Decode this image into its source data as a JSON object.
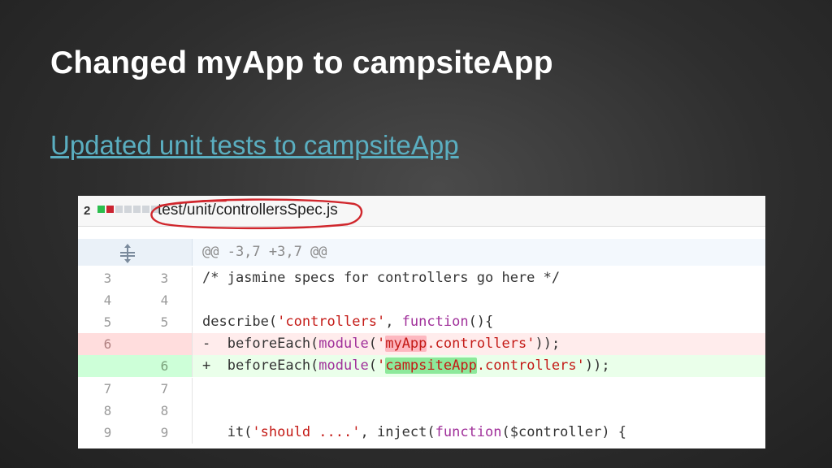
{
  "slide": {
    "title": "Changed myApp to campsiteApp",
    "link_text": "Updated unit tests to campsiteApp"
  },
  "diff": {
    "change_count": "2",
    "file_path": "test/unit/controllersSpec.js",
    "stat_colors": [
      "#2cbe4e",
      "#cb2431",
      "#d1d5da",
      "#d1d5da",
      "#d1d5da"
    ],
    "hunk_header": "@@ -3,7 +3,7 @@",
    "lines": [
      {
        "type": "context",
        "old": "3",
        "new": "3",
        "text": "/* jasmine specs for controllers go here */"
      },
      {
        "type": "context",
        "old": "4",
        "new": "4",
        "text": ""
      },
      {
        "type": "context",
        "old": "5",
        "new": "5",
        "text": "describe('controllers', function(){"
      },
      {
        "type": "deleted",
        "old": "6",
        "new": "",
        "text": "-  beforeEach(module('myApp.controllers'));"
      },
      {
        "type": "added",
        "old": "",
        "new": "6",
        "text": "+  beforeEach(module('campsiteApp.controllers'));"
      },
      {
        "type": "context",
        "old": "7",
        "new": "7",
        "text": ""
      },
      {
        "type": "context",
        "old": "8",
        "new": "8",
        "text": ""
      },
      {
        "type": "context",
        "old": "9",
        "new": "9",
        "text": "   it('should ....', inject(function($controller) {"
      }
    ],
    "tokens": {
      "l5_a": "describe(",
      "l5_b": "'controllers'",
      "l5_c": ", ",
      "l5_d": "function",
      "l5_e": "(){",
      "l6_pre": "-  beforeEach(",
      "l6_mod": "module",
      "l6_paren": "(",
      "l6_q1": "'",
      "l6_hl": "myApp",
      "l6_rest": ".controllers'",
      "l6_end": "));",
      "l7_pre": "+  beforeEach(",
      "l7_mod": "module",
      "l7_paren": "(",
      "l7_q1": "'",
      "l7_hl": "campsiteApp",
      "l7_rest": ".controllers'",
      "l7_end": "));",
      "l10_a": "   it(",
      "l10_b": "'should ....'",
      "l10_c": ", inject(",
      "l10_d": "function",
      "l10_e": "($controller) {"
    }
  }
}
